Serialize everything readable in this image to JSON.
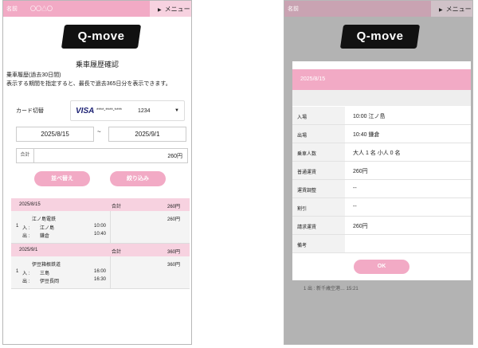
{
  "left": {
    "header": {
      "name_label": "名前",
      "name_value": "〇〇△〇",
      "menu_label": "メニュー"
    },
    "logo_text": "Q-move",
    "title": "乗車履歴確認",
    "notes": [
      "乗車履歴(過去30日間)",
      "表示する期間を指定すると、最長で過去365日分を表示できます。"
    ],
    "card": {
      "label": "カード切替",
      "brand": "VISA",
      "masked": "****-****-****",
      "last4": "1234"
    },
    "dates": {
      "from": "2025/8/15",
      "tilde": "~",
      "to": "2025/9/1"
    },
    "total": {
      "label": "合計",
      "value": "260円"
    },
    "buttons": {
      "sort": "並べ替え",
      "filter": "絞り込み"
    },
    "history": [
      {
        "date": "2025/8/15",
        "sum_label": "合計",
        "sum": "260円",
        "amount": "260円",
        "operator": "江ノ島電鉄",
        "count": "1",
        "in_label": "入 :",
        "in_station": "江ノ島",
        "in_time": "10:00",
        "out_label": "出 :",
        "out_station": "鎌倉",
        "out_time": "10:40"
      },
      {
        "date": "2025/9/1",
        "sum_label": "合計",
        "sum": "360円",
        "amount": "360円",
        "operator": "伊豆箱根鉄道",
        "count": "1",
        "in_label": "入 :",
        "in_station": "三島",
        "in_time": "16:00",
        "out_label": "出 :",
        "out_station": "伊豆長岡",
        "out_time": "16:30"
      }
    ]
  },
  "right": {
    "header": {
      "name_label": "名前",
      "menu_label": "メニュー"
    },
    "logo_text": "Q-move",
    "modal": {
      "date": "2025/8/15",
      "rows": [
        {
          "key": "入場",
          "value": "10:00 江ノ島"
        },
        {
          "key": "出場",
          "value": "10:40 鎌倉"
        },
        {
          "key": "乗車人数",
          "value": "大人 1 名 小人 0 名"
        },
        {
          "key": "普通運賃",
          "value": "260円"
        },
        {
          "key": "運賃調整",
          "value": "--"
        },
        {
          "key": "割引",
          "value": "--"
        },
        {
          "key": "請求運賃",
          "value": "260円"
        },
        {
          "key": "備考",
          "value": ""
        }
      ],
      "ok_label": "OK"
    },
    "background_fragment": "1 出 : 新千歳空港…  15:21"
  },
  "colors": {
    "accent": "#f2aac5",
    "accent_light": "#f7d2e0",
    "overlay": "#b3b3b3"
  }
}
